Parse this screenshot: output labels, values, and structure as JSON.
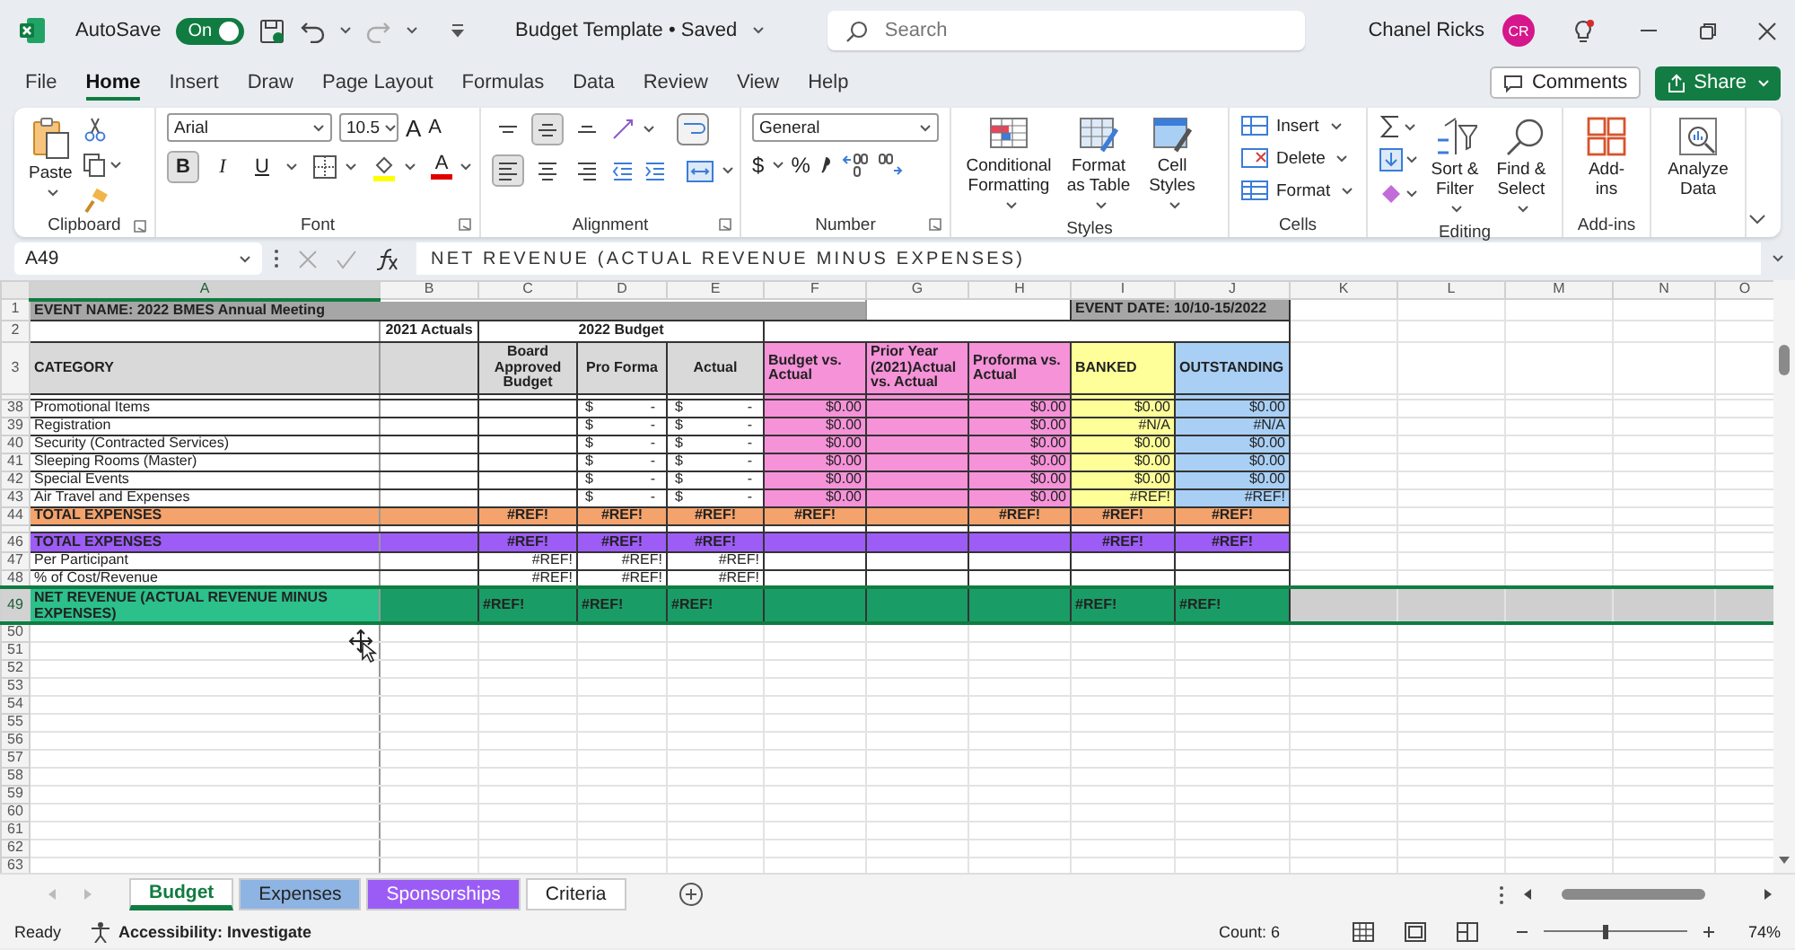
{
  "title_bar": {
    "autosave_label": "AutoSave",
    "autosave_on": true,
    "toggle_text": "On",
    "document_title": "Budget Template • Saved",
    "search_placeholder": "Search",
    "user_name": "Chanel Ricks",
    "avatar_initials": "CR"
  },
  "menu_tabs": [
    {
      "label": "File",
      "selected": false
    },
    {
      "label": "Home",
      "selected": true
    },
    {
      "label": "Insert",
      "selected": false
    },
    {
      "label": "Draw",
      "selected": false
    },
    {
      "label": "Page Layout",
      "selected": false
    },
    {
      "label": "Formulas",
      "selected": false
    },
    {
      "label": "Data",
      "selected": false
    },
    {
      "label": "Review",
      "selected": false
    },
    {
      "label": "View",
      "selected": false
    },
    {
      "label": "Help",
      "selected": false
    }
  ],
  "comments_button": "Comments",
  "share_button": "Share",
  "ribbon": {
    "clipboard": {
      "label": "Clipboard",
      "paste": "Paste"
    },
    "font": {
      "label": "Font",
      "font_name": "Arial",
      "font_size": "10.5",
      "grow": "A",
      "shrink": "A",
      "color_letter": "A",
      "styles": [
        {
          "label": "B",
          "pressed": true
        },
        {
          "label": "I",
          "pressed": false
        },
        {
          "label": "U",
          "pressed": false
        }
      ]
    },
    "alignment": {
      "label": "Alignment",
      "vertical": [
        {
          "selected": false
        },
        {
          "selected": true
        },
        {
          "selected": false
        }
      ],
      "horizontal": [
        {
          "selected": true
        },
        {
          "selected": false
        },
        {
          "selected": false
        }
      ]
    },
    "number": {
      "label": "Number",
      "format": "General",
      "currency": "$",
      "percent": "%"
    },
    "styles": {
      "label": "Styles",
      "buttons": [
        "Conditional Formatting",
        "Format as Table",
        "Cell Styles"
      ]
    },
    "cells": {
      "label": "Cells",
      "buttons": [
        "Insert",
        "Delete",
        "Format"
      ]
    },
    "editing": {
      "label": "Editing",
      "buttons": [
        "Sort & Filter",
        "Find & Select"
      ]
    },
    "addins": {
      "label": "Add-ins",
      "buttons": [
        "Add-ins"
      ]
    },
    "analyze": {
      "button": "Analyze Data"
    }
  },
  "formula_bar": {
    "name_box": "A49",
    "formula": "NET REVENUE (ACTUAL REVENUE MINUS EXPENSES)"
  },
  "grid": {
    "columns": [
      {
        "letter": "A",
        "selected": true
      },
      {
        "letter": "B",
        "selected": false
      },
      {
        "letter": "C",
        "selected": false
      },
      {
        "letter": "D",
        "selected": false
      },
      {
        "letter": "E",
        "selected": false
      },
      {
        "letter": "F",
        "selected": false
      },
      {
        "letter": "G",
        "selected": false
      },
      {
        "letter": "H",
        "selected": false
      },
      {
        "letter": "I",
        "selected": false
      },
      {
        "letter": "J",
        "selected": false
      },
      {
        "letter": "K",
        "selected": false
      },
      {
        "letter": "L",
        "selected": false
      },
      {
        "letter": "M",
        "selected": false
      },
      {
        "letter": "N",
        "selected": false
      },
      {
        "letter": "O",
        "selected": false
      }
    ],
    "rows": [
      {
        "number": "1",
        "kind": "event",
        "selected": false,
        "cells": {
          "A": "EVENT NAME: 2022 BMES Annual Meeting",
          "I": "EVENT DATE: 10/10-15/2022"
        }
      },
      {
        "number": "2",
        "kind": "group-heads",
        "selected": false,
        "cells": {
          "B": "2021 Actuals",
          "C": "2022 Budget"
        }
      },
      {
        "number": "3",
        "kind": "col-heads",
        "selected": false,
        "cells": {
          "A": "CATEGORY",
          "C": "Board Approved Budget",
          "D": "Pro Forma",
          "E": "Actual",
          "F": "Budget vs. Actual",
          "G": "Prior Year (2021)Actual vs. Actual",
          "H": "Proforma vs. Actual",
          "I": "BANKED",
          "J": "OUTSTANDING"
        }
      },
      {
        "kind": "cut",
        "selected": false,
        "cells": {}
      },
      {
        "number": "38",
        "kind": "item",
        "selected": false,
        "cells": {
          "A": "Promotional Items",
          "D": [
            "$",
            "-"
          ],
          "E": [
            "$",
            "-"
          ],
          "F": "$0.00",
          "H": "$0.00",
          "I": "$0.00",
          "J": "$0.00"
        }
      },
      {
        "number": "39",
        "kind": "item",
        "selected": false,
        "cells": {
          "A": "Registration",
          "D": [
            "$",
            "-"
          ],
          "E": [
            "$",
            "-"
          ],
          "F": "$0.00",
          "H": "$0.00",
          "I": "#N/A",
          "J": "#N/A"
        }
      },
      {
        "number": "40",
        "kind": "item",
        "selected": false,
        "cells": {
          "A": "Security (Contracted Services)",
          "D": [
            "$",
            "-"
          ],
          "E": [
            "$",
            "-"
          ],
          "F": "$0.00",
          "H": "$0.00",
          "I": "$0.00",
          "J": "$0.00"
        }
      },
      {
        "number": "41",
        "kind": "item",
        "selected": false,
        "cells": {
          "A": "Sleeping Rooms (Master)",
          "D": [
            "$",
            "-"
          ],
          "E": [
            "$",
            "-"
          ],
          "F": "$0.00",
          "H": "$0.00",
          "I": "$0.00",
          "J": "$0.00"
        }
      },
      {
        "number": "42",
        "kind": "item",
        "selected": false,
        "cells": {
          "A": "Special Events",
          "D": [
            "$",
            "-"
          ],
          "E": [
            "$",
            "-"
          ],
          "F": "$0.00",
          "H": "$0.00",
          "I": "$0.00",
          "J": "$0.00"
        }
      },
      {
        "number": "43",
        "kind": "item",
        "selected": false,
        "cells": {
          "A": "Air Travel and Expenses",
          "D": [
            "$",
            "-"
          ],
          "E": [
            "$",
            "-"
          ],
          "F": "$0.00",
          "H": "$0.00",
          "I": "#REF!",
          "J": "#REF!"
        }
      },
      {
        "number": "44",
        "kind": "total-orange",
        "selected": false,
        "cells": {
          "A": "TOTAL EXPENSES",
          "C": "#REF!",
          "D": "#REF!",
          "E": "#REF!",
          "F": "#REF!",
          "H": "#REF!",
          "I": "#REF!",
          "J": "#REF!"
        }
      },
      {
        "kind": "spacer",
        "selected": false,
        "cells": {}
      },
      {
        "number": "46",
        "kind": "total-purple",
        "selected": false,
        "cells": {
          "A": "TOTAL EXPENSES",
          "C": "#REF!",
          "D": "#REF!",
          "E": "#REF!",
          "I": "#REF!",
          "J": "#REF!"
        }
      },
      {
        "number": "47",
        "kind": "sub",
        "selected": false,
        "cells": {
          "A": "Per Participant",
          "C": "#REF!",
          "D": "#REF!",
          "E": "#REF!"
        }
      },
      {
        "number": "48",
        "kind": "sub",
        "selected": false,
        "cells": {
          "A": "% of Cost/Revenue",
          "C": "#REF!",
          "D": "#REF!",
          "E": "#REF!"
        }
      },
      {
        "number": "49",
        "kind": "net",
        "selected": true,
        "cells": {
          "A": "NET REVENUE (ACTUAL REVENUE MINUS EXPENSES)",
          "C": "#REF!",
          "D": "#REF!",
          "E": "#REF!",
          "I": "#REF!",
          "J": "#REF!"
        }
      },
      {
        "number": "50",
        "kind": "empty",
        "selected": false,
        "cells": {}
      },
      {
        "number": "51",
        "kind": "empty",
        "selected": false,
        "cells": {}
      },
      {
        "number": "52",
        "kind": "empty",
        "selected": false,
        "cells": {}
      },
      {
        "number": "53",
        "kind": "empty",
        "selected": false,
        "cells": {}
      },
      {
        "number": "54",
        "kind": "empty",
        "selected": false,
        "cells": {}
      },
      {
        "number": "55",
        "kind": "empty",
        "selected": false,
        "cells": {}
      },
      {
        "number": "56",
        "kind": "empty",
        "selected": false,
        "cells": {}
      },
      {
        "number": "57",
        "kind": "empty",
        "selected": false,
        "cells": {}
      },
      {
        "number": "58",
        "kind": "empty",
        "selected": false,
        "cells": {}
      },
      {
        "number": "59",
        "kind": "empty",
        "selected": false,
        "cells": {}
      },
      {
        "number": "60",
        "kind": "empty",
        "selected": false,
        "cells": {}
      },
      {
        "number": "61",
        "kind": "empty",
        "selected": false,
        "cells": {}
      },
      {
        "number": "62",
        "kind": "empty",
        "selected": false,
        "cells": {}
      },
      {
        "number": "63",
        "kind": "empty",
        "selected": false,
        "cells": {}
      }
    ]
  },
  "sheet_tabs": [
    {
      "label": "Budget",
      "selected": true,
      "color": "#107c41"
    },
    {
      "label": "Expenses",
      "selected": false,
      "color": "#8eb4e3"
    },
    {
      "label": "Sponsorships",
      "selected": false,
      "color": "#9b5cf6"
    },
    {
      "label": "Criteria",
      "selected": false
    }
  ],
  "status_bar": {
    "ready": "Ready",
    "accessibility": "Accessibility: Investigate",
    "count": "Count: 6",
    "zoom": "74%",
    "zoom_level": {
      "level": 0.43
    }
  }
}
